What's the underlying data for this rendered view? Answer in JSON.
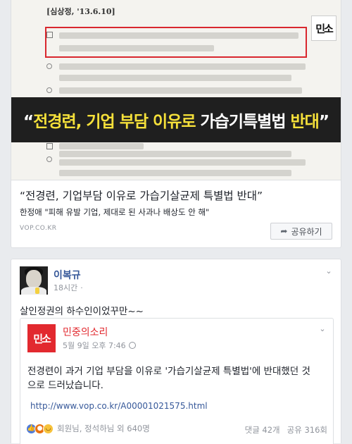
{
  "link_preview": {
    "image": {
      "doc_heading": "[심상정, '13.6.10]",
      "banner_open_quote": "“",
      "banner_part1": "전경련, 기업 부담 이유로",
      "banner_part2": " 가습기특별법 ",
      "banner_part3": "반대",
      "banner_close_quote": "”",
      "logo": "민소"
    },
    "title": "“전경련, 기업부담 이유로 가습기살균제 특별법 반대”",
    "description": "한정애 \"피해 유발 기업, 제대로 된 사과나 배상도 안 해\"",
    "domain": "VOP.CO.KR",
    "share_label": "공유하기"
  },
  "comment": {
    "author": "이복규",
    "time": "18시간",
    "text": "살인정권의 하수인이었꾸만~~"
  },
  "shared_post": {
    "page_name": "민중의소리",
    "time": "5월 9일 오후 7:46",
    "logo": "민소",
    "text_line1": "전경련이 과거 기업 부담을 이유로 '가습기살균제 특별법'에 반대했던 것",
    "text_line2": "으로 드러났습니다.",
    "link": "http://www.vop.co.kr/A00001021575.html",
    "reactions_text": "회원님, 정석하님 외 640명",
    "comments_count": "댓글 42개",
    "shares_count": "공유 316회"
  },
  "colors": {
    "link_blue": "#365899",
    "brand_red": "#e2292f",
    "banner_highlight": "#f5e03a"
  }
}
